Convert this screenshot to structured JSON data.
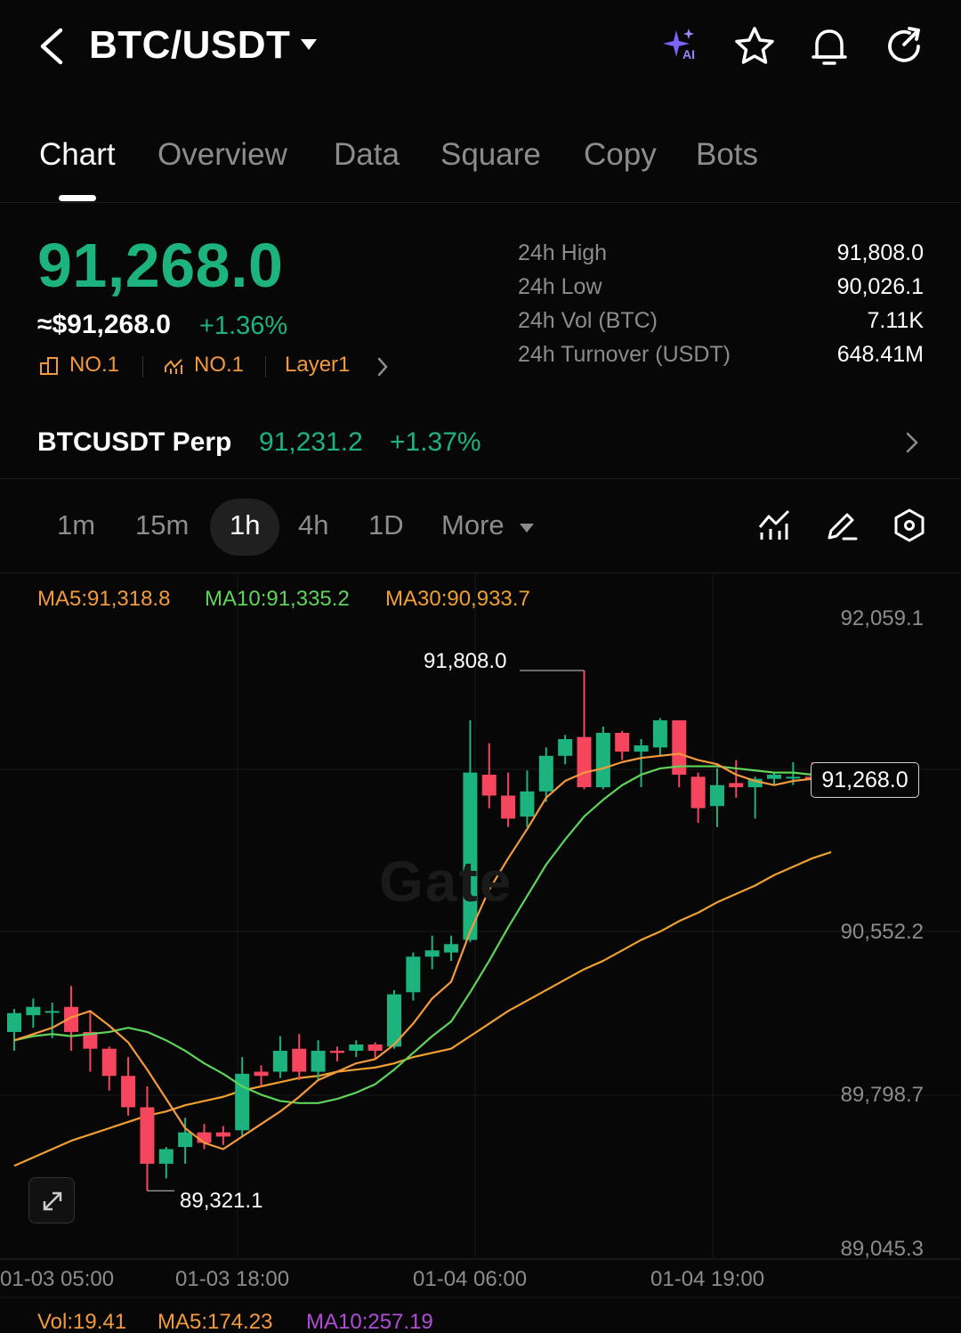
{
  "header": {
    "title": "BTC/USDT",
    "icons": [
      "back-icon",
      "ai-sparkle-icon",
      "star-icon",
      "bell-icon",
      "share-icon"
    ]
  },
  "tabs": [
    {
      "label": "Chart",
      "active": true
    },
    {
      "label": "Overview"
    },
    {
      "label": "Data"
    },
    {
      "label": "Square"
    },
    {
      "label": "Copy"
    },
    {
      "label": "Bots"
    }
  ],
  "ticker": {
    "last_price": "91,268.0",
    "usd_price": "≈$91,268.0",
    "change": "+1.36%",
    "rank_market_cap": "NO.1",
    "rank_trending": "NO.1",
    "sector": "Layer1",
    "color_up": "#1db37f",
    "color_down": "#f6465d",
    "color_accent": "#f39a3d"
  },
  "stats": [
    {
      "label": "24h  High",
      "value": "91,808.0"
    },
    {
      "label": "24h  Low",
      "value": "90,026.1"
    },
    {
      "label": "24h  Vol (BTC)",
      "value": "7.11K"
    },
    {
      "label": "24h  Turnover (USDT)",
      "value": "648.41M"
    }
  ],
  "perp": {
    "name": "BTCUSDT Perp",
    "price": "91,231.2",
    "change": "+1.37%"
  },
  "intervals": [
    {
      "label": "1m"
    },
    {
      "label": "15m"
    },
    {
      "label": "1h",
      "active": true
    },
    {
      "label": "4h"
    },
    {
      "label": "1D"
    },
    {
      "label": "More"
    }
  ],
  "tools": [
    "indicator-icon",
    "draw-pen-icon",
    "settings-hex-icon"
  ],
  "chart_data": {
    "type": "candlestick",
    "interval": "1h",
    "ma_legend": {
      "ma5": "MA5:91,318.8",
      "ma10": "MA10:91,335.2",
      "ma30": "MA30:90,933.7"
    },
    "ma_colors": {
      "ma5": "#f39a3d",
      "ma10": "#5fd35a",
      "ma30": "#f0a030"
    },
    "y_ticks": [
      "92,059.1",
      "90,552.2",
      "89,798.7",
      "89,045.3"
    ],
    "x_ticks": [
      "01-03 05:00",
      "01-03 18:00",
      "01-04 06:00",
      "01-04 19:00"
    ],
    "ylim": [
      89045.3,
      92059.1
    ],
    "current_price": "91,268.0",
    "high_marker": "91,808.0",
    "low_marker": "89,321.1",
    "watermark": "Gate",
    "candles": [
      {
        "o": 90080,
        "h": 90190,
        "c": 90170,
        "l": 89990
      },
      {
        "o": 90160,
        "h": 90240,
        "c": 90200,
        "l": 90100
      },
      {
        "o": 90180,
        "h": 90220,
        "c": 90180,
        "l": 90050
      },
      {
        "o": 90200,
        "h": 90300,
        "c": 90080,
        "l": 89990
      },
      {
        "o": 90080,
        "h": 90180,
        "c": 90000,
        "l": 89890
      },
      {
        "o": 90000,
        "h": 90010,
        "c": 89870,
        "l": 89800
      },
      {
        "o": 89870,
        "h": 89960,
        "c": 89720,
        "l": 89680
      },
      {
        "o": 89720,
        "h": 89820,
        "c": 89450,
        "l": 89321.1
      },
      {
        "o": 89450,
        "h": 89530,
        "c": 89520,
        "l": 89380
      },
      {
        "o": 89530,
        "h": 89670,
        "c": 89600,
        "l": 89450
      },
      {
        "o": 89600,
        "h": 89640,
        "c": 89550,
        "l": 89520
      },
      {
        "o": 89600,
        "h": 89630,
        "c": 89580,
        "l": 89540
      },
      {
        "o": 89610,
        "h": 89960,
        "c": 89880,
        "l": 89580
      },
      {
        "o": 89890,
        "h": 89920,
        "c": 89870,
        "l": 89820
      },
      {
        "o": 89890,
        "h": 90060,
        "c": 89990,
        "l": 89860
      },
      {
        "o": 90000,
        "h": 90070,
        "c": 89890,
        "l": 89850
      },
      {
        "o": 89890,
        "h": 90040,
        "c": 89990,
        "l": 89850
      },
      {
        "o": 89990,
        "h": 90010,
        "c": 89980,
        "l": 89940
      },
      {
        "o": 89990,
        "h": 90040,
        "c": 90020,
        "l": 89960
      },
      {
        "o": 90020,
        "h": 90030,
        "c": 89990,
        "l": 89950
      },
      {
        "o": 90010,
        "h": 90280,
        "c": 90260,
        "l": 90000
      },
      {
        "o": 90270,
        "h": 90460,
        "c": 90440,
        "l": 90230
      },
      {
        "o": 90440,
        "h": 90540,
        "c": 90470,
        "l": 90380
      },
      {
        "o": 90460,
        "h": 90540,
        "c": 90500,
        "l": 90420
      },
      {
        "o": 90520,
        "h": 91570,
        "c": 91320,
        "l": 90510
      },
      {
        "o": 91310,
        "h": 91460,
        "c": 91210,
        "l": 91150
      },
      {
        "o": 91210,
        "h": 91320,
        "c": 91100,
        "l": 91060
      },
      {
        "o": 91110,
        "h": 91330,
        "c": 91230,
        "l": 91060
      },
      {
        "o": 91230,
        "h": 91440,
        "c": 91400,
        "l": 91180
      },
      {
        "o": 91400,
        "h": 91500,
        "c": 91480,
        "l": 91360
      },
      {
        "o": 91490,
        "h": 91808.0,
        "c": 91250,
        "l": 91240
      },
      {
        "o": 91250,
        "h": 91540,
        "c": 91510,
        "l": 91240
      },
      {
        "o": 91510,
        "h": 91520,
        "c": 91420,
        "l": 91380
      },
      {
        "o": 91420,
        "h": 91480,
        "c": 91450,
        "l": 91250
      },
      {
        "o": 91440,
        "h": 91580,
        "c": 91570,
        "l": 91400
      },
      {
        "o": 91570,
        "h": 91570,
        "c": 91310,
        "l": 91250
      },
      {
        "o": 91300,
        "h": 91320,
        "c": 91150,
        "l": 91080
      },
      {
        "o": 91160,
        "h": 91340,
        "c": 91260,
        "l": 91060
      },
      {
        "o": 91270,
        "h": 91380,
        "c": 91250,
        "l": 91200
      },
      {
        "o": 91250,
        "h": 91300,
        "c": 91290,
        "l": 91100
      },
      {
        "o": 91290,
        "h": 91320,
        "c": 91310,
        "l": 91260
      },
      {
        "o": 91300,
        "h": 91370,
        "c": 91300,
        "l": 91260
      },
      {
        "o": 91300,
        "h": 91370,
        "c": 91290,
        "l": 91260
      },
      {
        "o": 91300,
        "h": 91320,
        "c": 91268,
        "l": 91250
      }
    ],
    "ma5": [
      90040,
      90070,
      90100,
      90150,
      90180,
      90110,
      90030,
      89900,
      89760,
      89620,
      89550,
      89520,
      89580,
      89640,
      89700,
      89770,
      89850,
      89890,
      89930,
      89950,
      90020,
      90120,
      90240,
      90320,
      90560,
      90760,
      90910,
      91050,
      91200,
      91280,
      91320,
      91340,
      91370,
      91390,
      91400,
      91410,
      91380,
      91360,
      91310,
      91280,
      91260,
      91280,
      91290,
      91300
    ],
    "ma10": [
      90040,
      90060,
      90070,
      90060,
      90070,
      90080,
      90100,
      90080,
      90040,
      89990,
      89930,
      89880,
      89820,
      89780,
      89750,
      89740,
      89740,
      89760,
      89790,
      89830,
      89900,
      89980,
      90060,
      90130,
      90270,
      90420,
      90580,
      90730,
      90880,
      91000,
      91110,
      91190,
      91260,
      91310,
      91340,
      91350,
      91350,
      91350,
      91340,
      91330,
      91320,
      91320,
      91310,
      91310
    ],
    "ma30": [
      89440,
      89480,
      89520,
      89560,
      89590,
      89620,
      89650,
      89680,
      89700,
      89730,
      89750,
      89770,
      89800,
      89820,
      89840,
      89860,
      89870,
      89890,
      89900,
      89910,
      89930,
      89960,
      89980,
      90000,
      90060,
      90120,
      90180,
      90230,
      90280,
      90330,
      90380,
      90420,
      90470,
      90520,
      90560,
      90610,
      90650,
      90700,
      90740,
      90780,
      90830,
      90870,
      90910,
      90940
    ],
    "volume_legend": {
      "vol": "Vol:19.41",
      "ma5": "MA5:174.23",
      "ma10": "MA10:257.19"
    }
  }
}
